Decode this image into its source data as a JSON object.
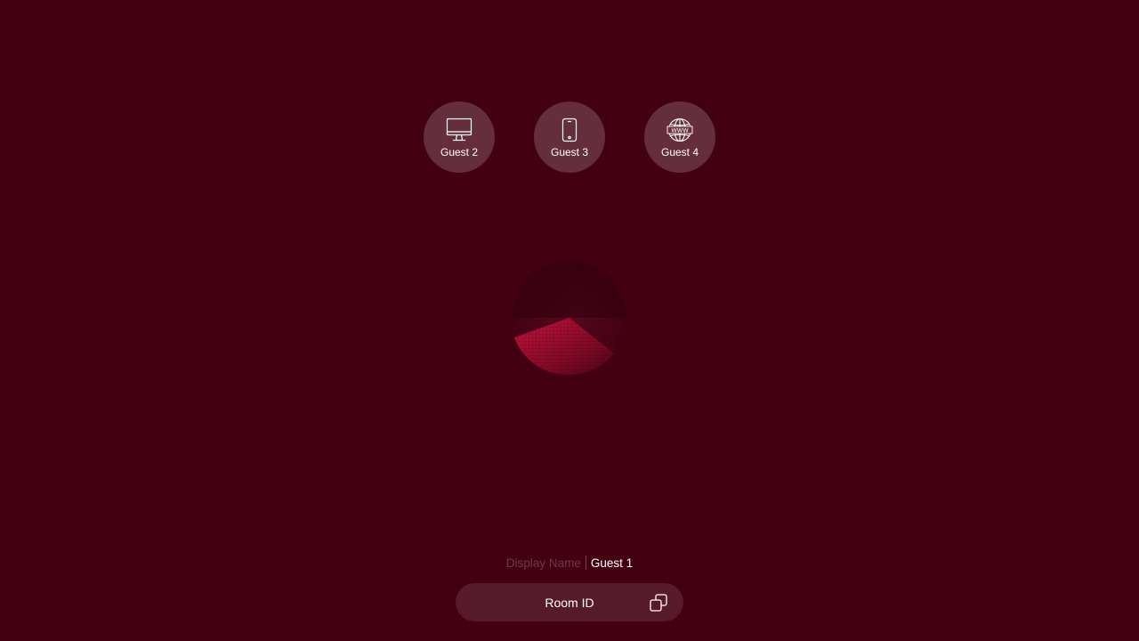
{
  "peers": [
    {
      "name": "Guest 2",
      "device": "desktop-icon"
    },
    {
      "name": "Guest 3",
      "device": "phone-icon"
    },
    {
      "name": "Guest 4",
      "device": "globe-www-icon",
      "icon_text": "WWW"
    }
  ],
  "display_name": {
    "label": "Display Name",
    "value": "Guest 1"
  },
  "room": {
    "label": "Room ID",
    "copy_icon": "copy-icon"
  },
  "colors": {
    "background": "#440013",
    "accent": "#c8103e"
  }
}
